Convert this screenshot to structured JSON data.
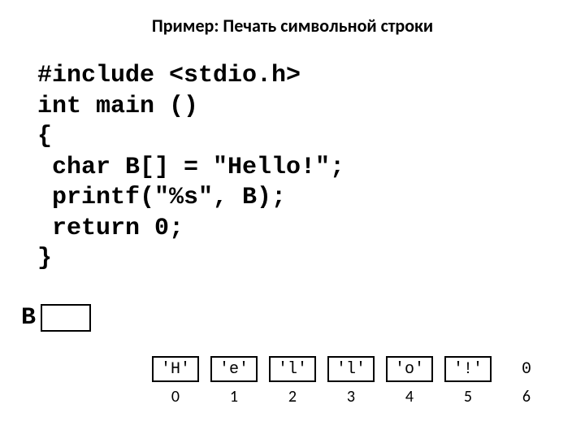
{
  "title": "Пример: Печать символьной строки",
  "code": "#include <stdio.h>\nint main ()\n{\n char B[] = \"Hello!\";\n printf(\"%s\", B);\n return 0;\n}",
  "pointer_label": "B",
  "cells": [
    {
      "value": "'H'",
      "index": "0",
      "boxed": true
    },
    {
      "value": "'e'",
      "index": "1",
      "boxed": true
    },
    {
      "value": "'l'",
      "index": "2",
      "boxed": true
    },
    {
      "value": "'l'",
      "index": "3",
      "boxed": true
    },
    {
      "value": "'o'",
      "index": "4",
      "boxed": true
    },
    {
      "value": "'!'",
      "index": "5",
      "boxed": true
    },
    {
      "value": "0",
      "index": "6",
      "boxed": false
    }
  ]
}
